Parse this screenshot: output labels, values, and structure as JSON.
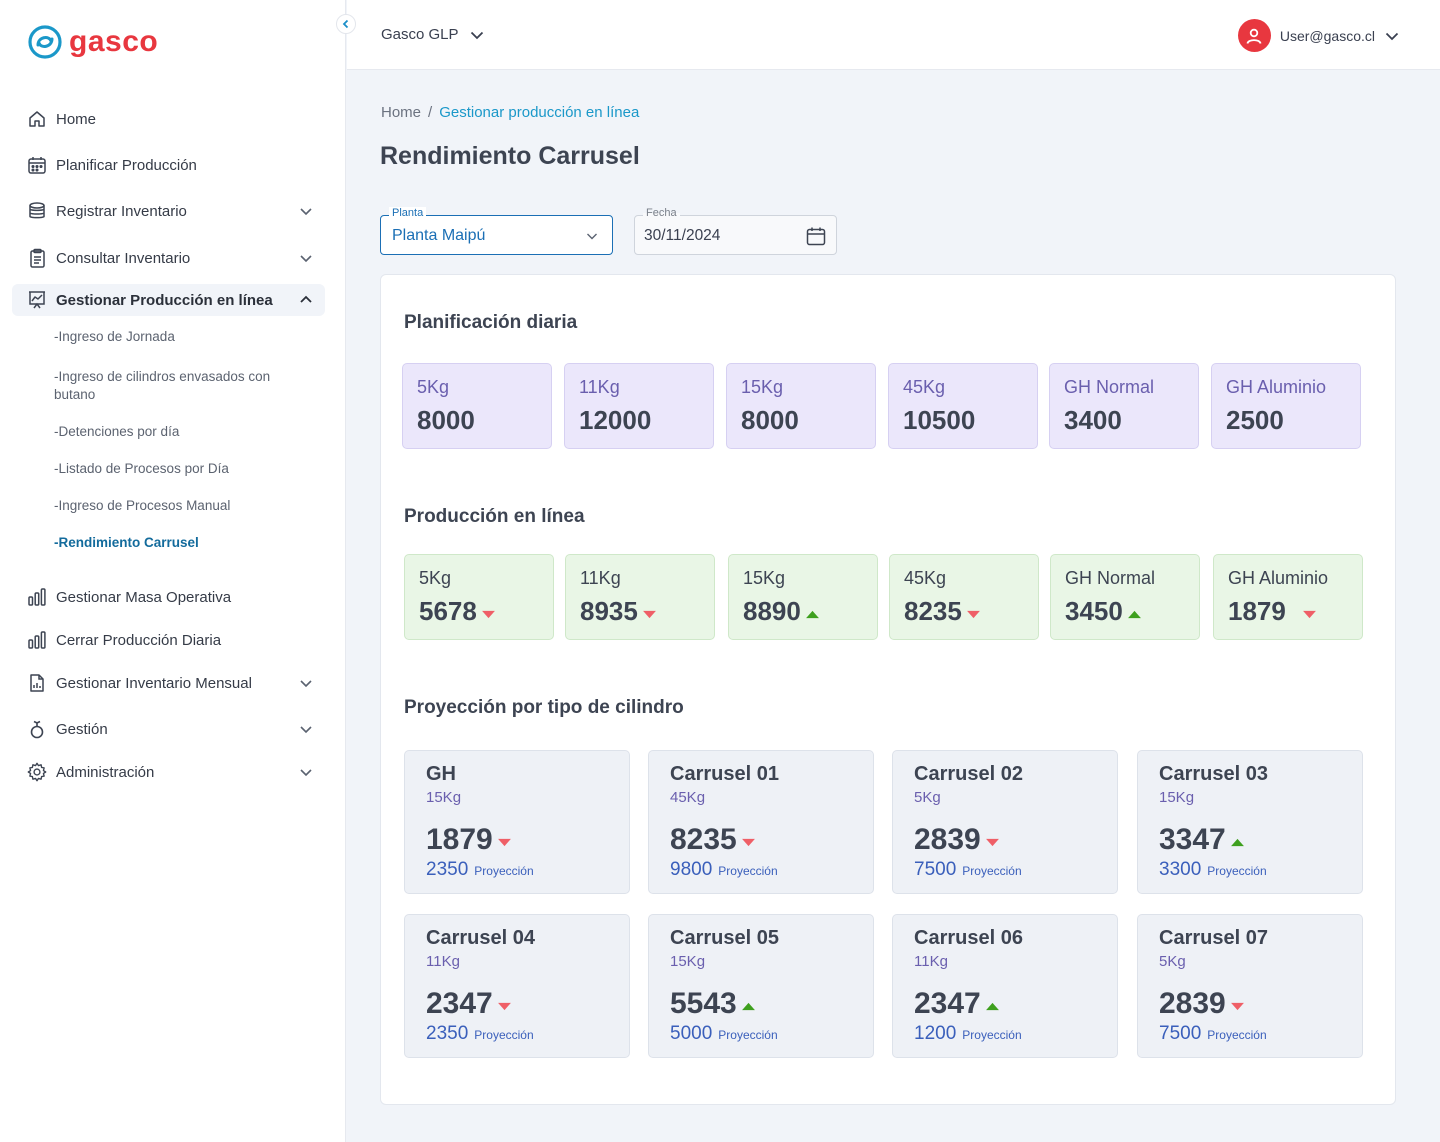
{
  "brand": {
    "name": "gasco",
    "color": "#e8373f"
  },
  "sidebar": {
    "items": [
      {
        "label": "Home",
        "icon": "home-icon"
      },
      {
        "label": "Planificar Producción",
        "icon": "calendar-icon"
      },
      {
        "label": "Registrar Inventario",
        "icon": "database-icon"
      },
      {
        "label": "Consultar Inventario",
        "icon": "clipboard-icon"
      },
      {
        "label": "Gestionar Producción en línea",
        "icon": "chart-board-icon"
      },
      {
        "label": "Gestionar Masa Operativa",
        "icon": "bar-chart-icon"
      },
      {
        "label": "Cerrar Producción Diaria",
        "icon": "bar-chart-icon"
      },
      {
        "label": "Gestionar Inventario Mensual",
        "icon": "document-chart-icon"
      },
      {
        "label": "Gestión",
        "icon": "gestion-icon"
      },
      {
        "label": "Administración",
        "icon": "gear-icon"
      }
    ],
    "subitems": [
      "-Ingreso de Jornada",
      "-Ingreso de cilindros envasados con butano",
      "-Detenciones por día",
      "-Listado de Procesos por Día",
      "-Ingreso de Procesos Manual",
      "-Rendimiento Carrusel"
    ]
  },
  "header": {
    "company": "Gasco GLP",
    "user": "User@gasco.cl"
  },
  "breadcrumb": {
    "home": "Home",
    "sep": "/",
    "current": "Gestionar producción en línea"
  },
  "page_title": "Rendimiento Carrusel",
  "filters": {
    "planta_label": "Planta",
    "planta_value": "Planta Maipú",
    "fecha_label": "Fecha",
    "fecha_value": "30/11/2024"
  },
  "planificacion": {
    "title": "Planificación diaria",
    "tiles": [
      {
        "label": "5Kg",
        "value": "8000"
      },
      {
        "label": "11Kg",
        "value": "12000"
      },
      {
        "label": "15Kg",
        "value": "8000"
      },
      {
        "label": "45Kg",
        "value": "10500"
      },
      {
        "label": "GH Normal",
        "value": "3400"
      },
      {
        "label": "GH Aluminio",
        "value": "2500"
      }
    ]
  },
  "produccion": {
    "title": "Producción en línea",
    "tiles": [
      {
        "label": "5Kg",
        "value": "5678",
        "trend": "down"
      },
      {
        "label": "11Kg",
        "value": "8935",
        "trend": "down"
      },
      {
        "label": "15Kg",
        "value": "8890",
        "trend": "up"
      },
      {
        "label": "45Kg",
        "value": "8235",
        "trend": "down"
      },
      {
        "label": "GH Normal",
        "value": "3450",
        "trend": "up"
      },
      {
        "label": "GH Aluminio",
        "value": "1879",
        "trend": "down"
      }
    ]
  },
  "proyeccion": {
    "title": "Proyección por tipo de cilindro",
    "target_label": "Proyección",
    "cards": [
      {
        "title": "GH",
        "sub": "15Kg",
        "value": "1879",
        "trend": "down",
        "target": "2350"
      },
      {
        "title": "Carrusel 01",
        "sub": "45Kg",
        "value": "8235",
        "trend": "down",
        "target": "9800"
      },
      {
        "title": "Carrusel 02",
        "sub": "5Kg",
        "value": "2839",
        "trend": "down",
        "target": "7500"
      },
      {
        "title": "Carrusel 03",
        "sub": "15Kg",
        "value": "3347",
        "trend": "up",
        "target": "3300"
      },
      {
        "title": "Carrusel 04",
        "sub": "11Kg",
        "value": "2347",
        "trend": "down",
        "target": "2350"
      },
      {
        "title": "Carrusel 05",
        "sub": "15Kg",
        "value": "5543",
        "trend": "up",
        "target": "5000"
      },
      {
        "title": "Carrusel 06",
        "sub": "11Kg",
        "value": "2347",
        "trend": "up",
        "target": "1200"
      },
      {
        "title": "Carrusel 07",
        "sub": "5Kg",
        "value": "2839",
        "trend": "down",
        "target": "7500"
      }
    ]
  },
  "colors": {
    "up": "#3ea01e",
    "down": "#ef5f67",
    "accent": "#1b98c9",
    "plan_bg": "#ebe7fb",
    "prod_bg": "#e9f6e6"
  }
}
